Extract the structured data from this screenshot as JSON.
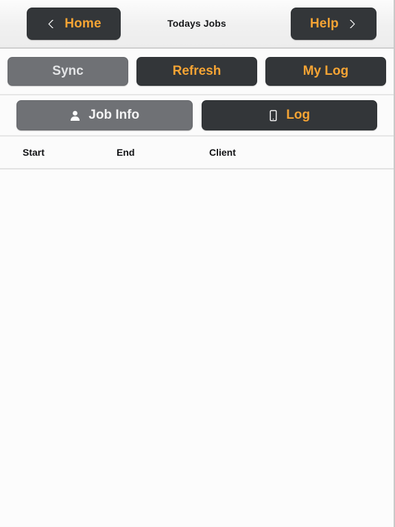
{
  "header": {
    "title": "Todays Jobs",
    "back_button": {
      "label": "Home",
      "icon": "chevron-left-icon"
    },
    "help_button": {
      "label": "Help",
      "icon": "chevron-right-icon"
    }
  },
  "actions": [
    {
      "label": "Sync",
      "state": "active"
    },
    {
      "label": "Refresh",
      "state": "default"
    },
    {
      "label": "My Log",
      "state": "default"
    }
  ],
  "tabs": [
    {
      "label": "Job Info",
      "icon": "user-icon",
      "state": "active"
    },
    {
      "label": "Log",
      "icon": "tablet-icon",
      "state": "default"
    }
  ],
  "table": {
    "columns": [
      "Start",
      "End",
      "Client"
    ],
    "rows": []
  },
  "colors": {
    "accent_orange": "#f6a434",
    "dark_button": "#333639",
    "active_gray": "#6f7175",
    "page_background": "#fbfbfb",
    "header_background": "#f0f0f0",
    "text_dark": "#111214"
  }
}
